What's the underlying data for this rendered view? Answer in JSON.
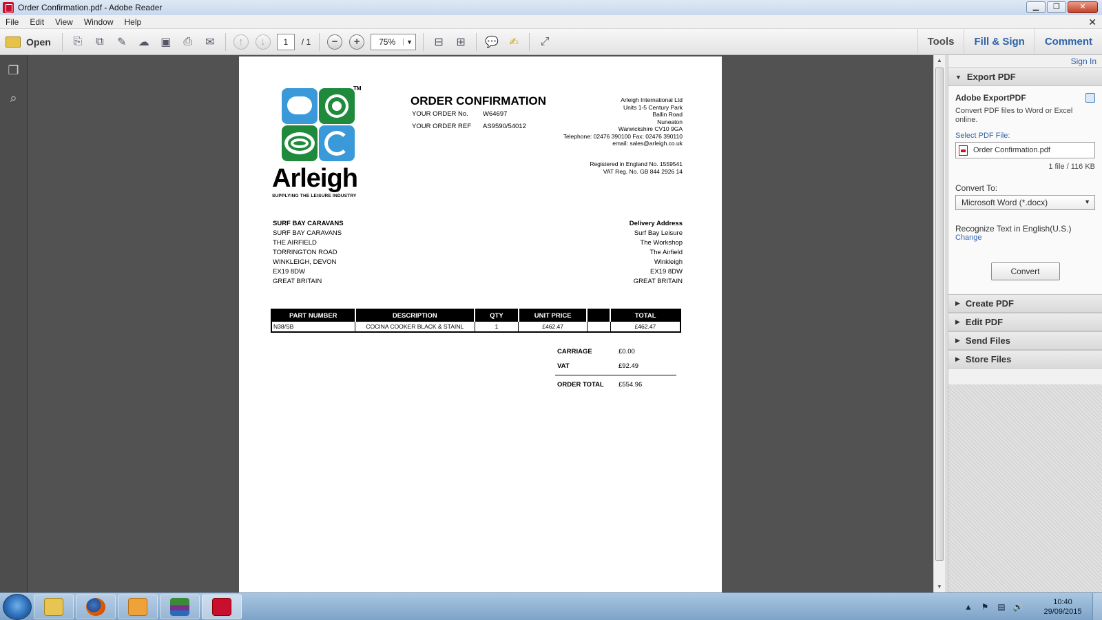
{
  "window": {
    "title": "Order Confirmation.pdf - Adobe Reader",
    "controls": {
      "minimize": "▁",
      "restore": "❐",
      "close": "✕"
    },
    "doc_close": "✕"
  },
  "menu": [
    "File",
    "Edit",
    "View",
    "Window",
    "Help"
  ],
  "toolbar": {
    "open_label": "Open",
    "page_current": "1",
    "page_total": "/ 1",
    "zoom": "75%",
    "tabs": [
      "Tools",
      "Fill & Sign",
      "Comment"
    ]
  },
  "document": {
    "logo": {
      "brand": "Arleigh",
      "tagline": "SUPPLYING THE LEISURE INDUSTRY",
      "tm": "TM"
    },
    "title": "ORDER CONFIRMATION",
    "fields": [
      {
        "label": "YOUR ORDER No.",
        "value": "W64697"
      },
      {
        "label": "YOUR ORDER REF",
        "value": "AS9590/54012"
      }
    ],
    "company": [
      "Arleigh International Ltd",
      "Units 1-5 Century Park",
      "Ballin Road",
      "Nuneaton",
      "Warwickshire CV10 9GA",
      "Telephone: 02476 390100 Fax: 02476 390110",
      "email: sales@arleigh.co.uk"
    ],
    "registered": [
      "Registered in England No. 1559541",
      "VAT Reg. No. GB 844 2926 14"
    ],
    "billing_address": [
      "SURF BAY CARAVANS",
      "SURF BAY CARAVANS",
      "THE AIRFIELD",
      "TORRINGTON ROAD",
      "WINKLEIGH, DEVON",
      "EX19 8DW",
      "GREAT BRITAIN"
    ],
    "delivery_address": [
      "Delivery Address",
      "Surf Bay Leisure",
      "The Workshop",
      "The Airfield",
      "Winkleigh",
      "EX19 8DW",
      "GREAT BRITAIN"
    ],
    "table": {
      "headers": [
        "PART NUMBER",
        "DESCRIPTION",
        "QTY",
        "UNIT PRICE",
        "",
        "TOTAL"
      ],
      "rows": [
        [
          "N38/SB",
          "COCINA COOKER BLACK & STAINL",
          "1",
          "£462.47",
          "",
          "£462.47"
        ]
      ]
    },
    "totals": [
      {
        "label": "CARRIAGE",
        "value": "£0.00"
      },
      {
        "label": "VAT",
        "value": "£92.49"
      },
      {
        "label": "ORDER TOTAL",
        "value": "£554.96"
      }
    ]
  },
  "right_pane": {
    "sign_in": "Sign In",
    "export_header": "Export PDF",
    "export_title": "Adobe ExportPDF",
    "export_desc": "Convert PDF files to Word or Excel online.",
    "select_label": "Select PDF File:",
    "file_name": "Order Confirmation.pdf",
    "file_info": "1 file / 116 KB",
    "convert_to_label": "Convert To:",
    "convert_to_value": "Microsoft Word (*.docx)",
    "recognize": "Recognize Text in English(U.S.)",
    "change": "Change",
    "convert_button": "Convert",
    "sections": [
      "Create PDF",
      "Edit PDF",
      "Send Files",
      "Store Files"
    ]
  },
  "taskbar": {
    "clock_time": "10:40",
    "clock_date": "29/09/2015"
  },
  "colors": {
    "accent_blue": "#2e63a8",
    "viewer_bg": "#525252",
    "logo_blue": "#3a9ad9",
    "logo_green": "#1f8a3c"
  }
}
